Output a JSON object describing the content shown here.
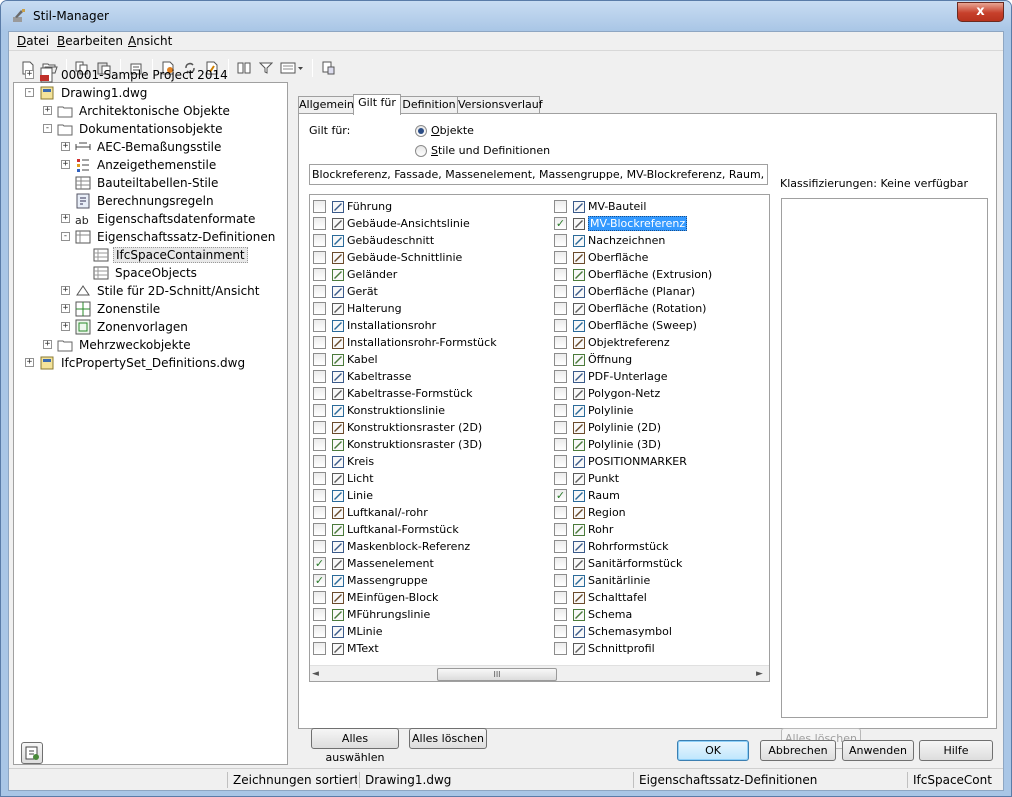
{
  "window": {
    "title": "Stil-Manager",
    "close_glyph": "x"
  },
  "menu": [
    {
      "label": "Datei",
      "key": "D",
      "rest": "atei"
    },
    {
      "label": "Bearbeiten",
      "key": "B",
      "rest": "earbeiten"
    },
    {
      "label": "Ansicht",
      "key": "A",
      "rest": "nsicht"
    }
  ],
  "toolbar": [
    "new-icon",
    "open-icon",
    "copy-icon",
    "paste-icon",
    "purge-icon",
    "edit-style-icon",
    "sync-icon",
    "update-icon",
    "compare-icon",
    "filter-icon",
    "view-dropdown-icon",
    "toggle-view-icon"
  ],
  "tree": [
    {
      "label": "00001-Sample Project 2014",
      "icon": "project-icon",
      "exp": "+"
    },
    {
      "label": "Drawing1.dwg",
      "icon": "drawing-icon",
      "exp": "-"
    },
    {
      "label": "Architektonische Objekte",
      "icon": "folder-icon",
      "exp": "+"
    },
    {
      "label": "Dokumentationsobjekte",
      "icon": "folder-icon",
      "exp": "-"
    },
    {
      "label": "AEC-Bemaßungsstile",
      "icon": "dimension-style-icon",
      "exp": "+"
    },
    {
      "label": "Anzeigethemenstile",
      "icon": "display-theme-icon",
      "exp": "+"
    },
    {
      "label": "Bauteiltabellen-Stile",
      "icon": "table-style-icon",
      "exp": ""
    },
    {
      "label": "Berechnungsregeln",
      "icon": "calc-rule-icon",
      "exp": ""
    },
    {
      "label": "Eigenschaftsdatenformate",
      "icon": "data-format-icon",
      "exp": "+"
    },
    {
      "label": "Eigenschaftssatz-Definitionen",
      "icon": "property-set-icon",
      "exp": "-"
    },
    {
      "label": "IfcSpaceContainment",
      "icon": "property-def-icon",
      "exp": "",
      "selected": true
    },
    {
      "label": "SpaceObjects",
      "icon": "property-def-icon",
      "exp": ""
    },
    {
      "label": "Stile für 2D-Schnitt/Ansicht",
      "icon": "section-style-icon",
      "exp": "+"
    },
    {
      "label": "Zonenstile",
      "icon": "zone-style-icon",
      "exp": "+"
    },
    {
      "label": "Zonenvorlagen",
      "icon": "zone-template-icon",
      "exp": "+"
    },
    {
      "label": "Mehrzweckobjekte",
      "icon": "folder-icon",
      "exp": "+"
    },
    {
      "label": "IfcPropertySet_Definitions.dwg",
      "icon": "drawing-icon",
      "exp": "+"
    }
  ],
  "tabs": [
    "Allgemein",
    "Gilt für",
    "Definition",
    "Versionsverlauf"
  ],
  "applies_to": {
    "label": "Gilt für:",
    "options": [
      {
        "label": "Objekte",
        "key": "O",
        "rest": "bjekte",
        "checked": true
      },
      {
        "label": "Stile und Definitionen",
        "key": "S",
        "rest": "tile und Definitionen",
        "checked": false
      }
    ],
    "summary": "Blockreferenz, Fassade, Massenelement, Massengruppe, MV-Blockreferenz, Raum, Tür, Tür-..."
  },
  "objects_left": [
    {
      "label": "Führung",
      "checked": false
    },
    {
      "label": "Gebäude-Ansichtslinie",
      "checked": false
    },
    {
      "label": "Gebäudeschnitt",
      "checked": false
    },
    {
      "label": "Gebäude-Schnittlinie",
      "checked": false
    },
    {
      "label": "Geländer",
      "checked": false
    },
    {
      "label": "Gerät",
      "checked": false
    },
    {
      "label": "Halterung",
      "checked": false
    },
    {
      "label": "Installationsrohr",
      "checked": false
    },
    {
      "label": "Installationsrohr-Formstück",
      "checked": false
    },
    {
      "label": "Kabel",
      "checked": false
    },
    {
      "label": "Kabeltrasse",
      "checked": false
    },
    {
      "label": "Kabeltrasse-Formstück",
      "checked": false
    },
    {
      "label": "Konstruktionslinie",
      "checked": false
    },
    {
      "label": "Konstruktionsraster (2D)",
      "checked": false
    },
    {
      "label": "Konstruktionsraster (3D)",
      "checked": false
    },
    {
      "label": "Kreis",
      "checked": false
    },
    {
      "label": "Licht",
      "checked": false
    },
    {
      "label": "Linie",
      "checked": false
    },
    {
      "label": "Luftkanal/-rohr",
      "checked": false
    },
    {
      "label": "Luftkanal-Formstück",
      "checked": false
    },
    {
      "label": "Maskenblock-Referenz",
      "checked": false
    },
    {
      "label": "Massenelement",
      "checked": true
    },
    {
      "label": "Massengruppe",
      "checked": true
    },
    {
      "label": "MEinfügen-Block",
      "checked": false
    },
    {
      "label": "MFührungslinie",
      "checked": false
    },
    {
      "label": "MLinie",
      "checked": false
    },
    {
      "label": "MText",
      "checked": false
    }
  ],
  "objects_right": [
    {
      "label": "MV-Bauteil",
      "checked": false
    },
    {
      "label": "MV-Blockreferenz",
      "checked": true,
      "selected": true
    },
    {
      "label": "Nachzeichnen",
      "checked": false
    },
    {
      "label": "Oberfläche",
      "checked": false
    },
    {
      "label": "Oberfläche (Extrusion)",
      "checked": false
    },
    {
      "label": "Oberfläche (Planar)",
      "checked": false
    },
    {
      "label": "Oberfläche (Rotation)",
      "checked": false
    },
    {
      "label": "Oberfläche (Sweep)",
      "checked": false
    },
    {
      "label": "Objektreferenz",
      "checked": false
    },
    {
      "label": "Öffnung",
      "checked": false
    },
    {
      "label": "PDF-Unterlage",
      "checked": false
    },
    {
      "label": "Polygon-Netz",
      "checked": false
    },
    {
      "label": "Polylinie",
      "checked": false
    },
    {
      "label": "Polylinie (2D)",
      "checked": false
    },
    {
      "label": "Polylinie (3D)",
      "checked": false
    },
    {
      "label": "POSITIONMARKER",
      "checked": false
    },
    {
      "label": "Punkt",
      "checked": false
    },
    {
      "label": "Raum",
      "checked": true
    },
    {
      "label": "Region",
      "checked": false
    },
    {
      "label": "Rohr",
      "checked": false
    },
    {
      "label": "Rohrformstück",
      "checked": false
    },
    {
      "label": "Sanitärformstück",
      "checked": false
    },
    {
      "label": "Sanitärlinie",
      "checked": false
    },
    {
      "label": "Schalttafel",
      "checked": false
    },
    {
      "label": "Schema",
      "checked": false
    },
    {
      "label": "Schemasymbol",
      "checked": false
    },
    {
      "label": "Schnittprofil",
      "checked": false
    }
  ],
  "scroll": {
    "thumb_glyph": "III",
    "left_arrow": "◄",
    "right_arrow": "►"
  },
  "classification": {
    "label": "Klassifizierungen: Keine verfügbar"
  },
  "buttons": {
    "select_all": "Alles auswählen",
    "clear_all": "Alles löschen",
    "clear_all_class": "Alles löschen",
    "ok": "OK",
    "cancel": "Abbrechen",
    "apply": "Anwenden",
    "help": "Hilfe"
  },
  "status": {
    "sort": "Zeichnungen sortiert",
    "drawing": "Drawing1.dwg",
    "category": "Eigenschaftssatz-Definitionen",
    "item": "IfcSpaceCont"
  },
  "colors": {
    "accent": "#3399ff",
    "check": "#2a7a2a",
    "titlebar": "#a9c6e6",
    "close": "#c7402b"
  }
}
